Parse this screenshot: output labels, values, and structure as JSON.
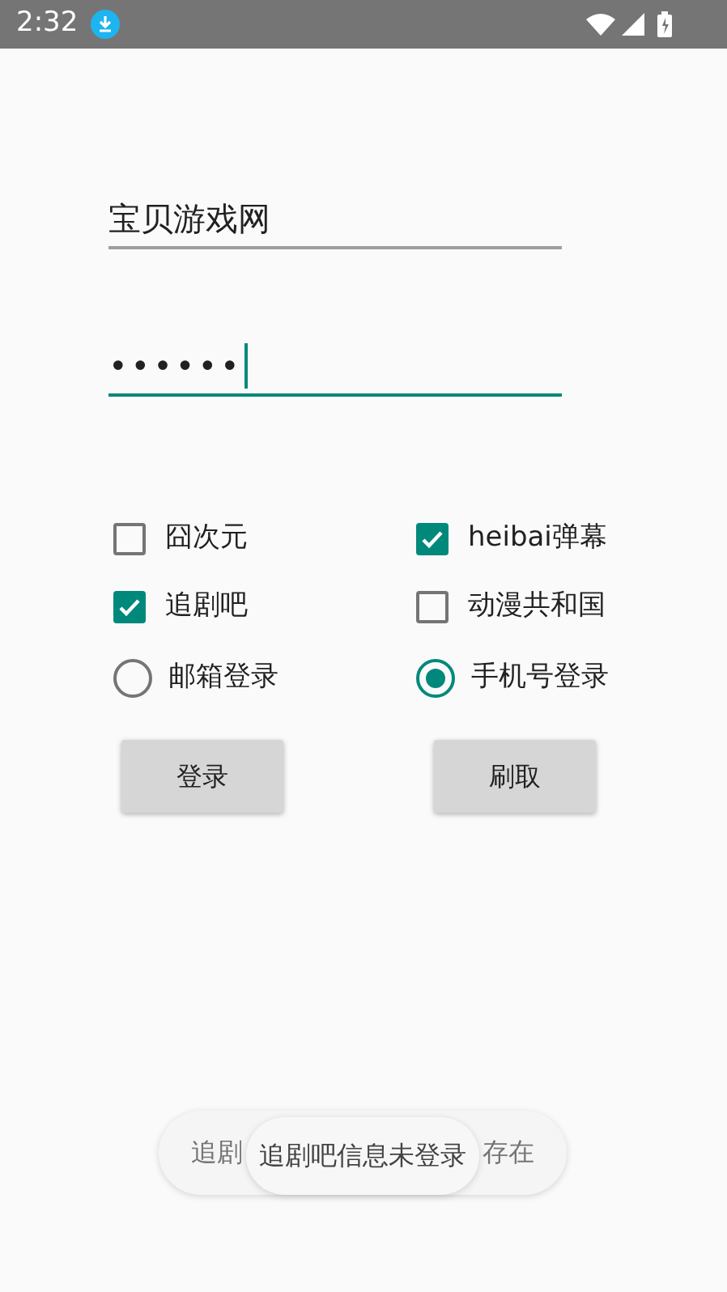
{
  "status_bar": {
    "time": "2:32"
  },
  "username": {
    "value": "宝贝游戏网",
    "focused": false
  },
  "password": {
    "value": "••••••",
    "focused": true
  },
  "checkboxes": [
    {
      "label": "囧次元",
      "checked": false
    },
    {
      "label": "heibai弹幕",
      "checked": true
    },
    {
      "label": "追剧吧",
      "checked": true
    },
    {
      "label": "动漫共和国",
      "checked": false
    }
  ],
  "radios": [
    {
      "label": "邮箱登录",
      "selected": false
    },
    {
      "label": "手机号登录",
      "selected": true
    }
  ],
  "buttons": [
    "登录",
    "刷取"
  ],
  "back_toast": {
    "start": "追剧",
    "end": "存在"
  },
  "front_toast": "追剧吧信息未登录"
}
